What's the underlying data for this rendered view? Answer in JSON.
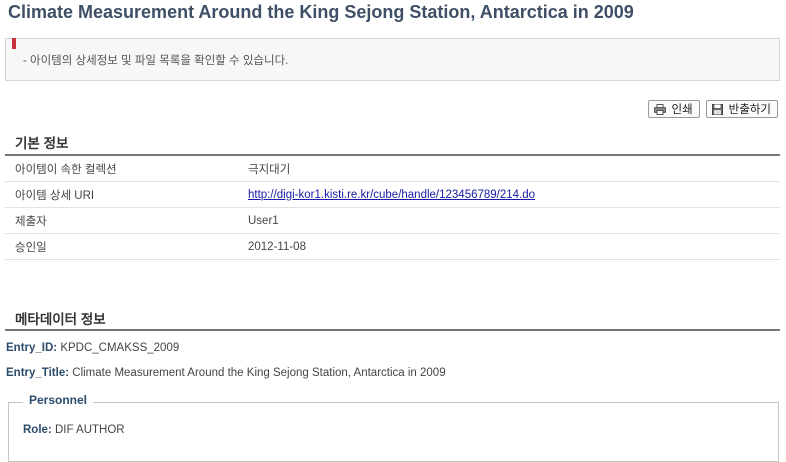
{
  "page": {
    "title": "Climate Measurement Around the King Sejong Station, Antarctica in 2009",
    "notice": "- 아이템의 상세정보 및 파일 목록을 확인할 수 있습니다."
  },
  "toolbar": {
    "print_label": "인쇄",
    "export_label": "반출하기",
    "print_icon": "printer-icon",
    "export_icon": "floppy-disk-icon"
  },
  "basic_info": {
    "heading": "기본 정보",
    "rows": [
      {
        "label": "아이템이 속한 컬렉션",
        "value": "극지대기"
      },
      {
        "label": "아이템 상세 URI",
        "value": "http://digi-kor1.kisti.re.kr/cube/handle/123456789/214.do"
      },
      {
        "label": "제출자",
        "value": "User1"
      },
      {
        "label": "승인일",
        "value": "2012-11-08"
      }
    ]
  },
  "metadata": {
    "heading": "메타데이터 정보",
    "entry_id_key": "Entry_ID:",
    "entry_id_value": "KPDC_CMAKSS_2009",
    "entry_title_key": "Entry_Title:",
    "entry_title_value": "Climate Measurement Around the King Sejong Station, Antarctica in 2009",
    "personnel": {
      "legend": "Personnel",
      "role_key": "Role:",
      "role_value": "DIF AUTHOR"
    }
  },
  "colors": {
    "title": "#3f4f66",
    "accent_marker": "#c8323c",
    "metadata_key": "#2c4c6c",
    "link": "#1a1aa6"
  }
}
